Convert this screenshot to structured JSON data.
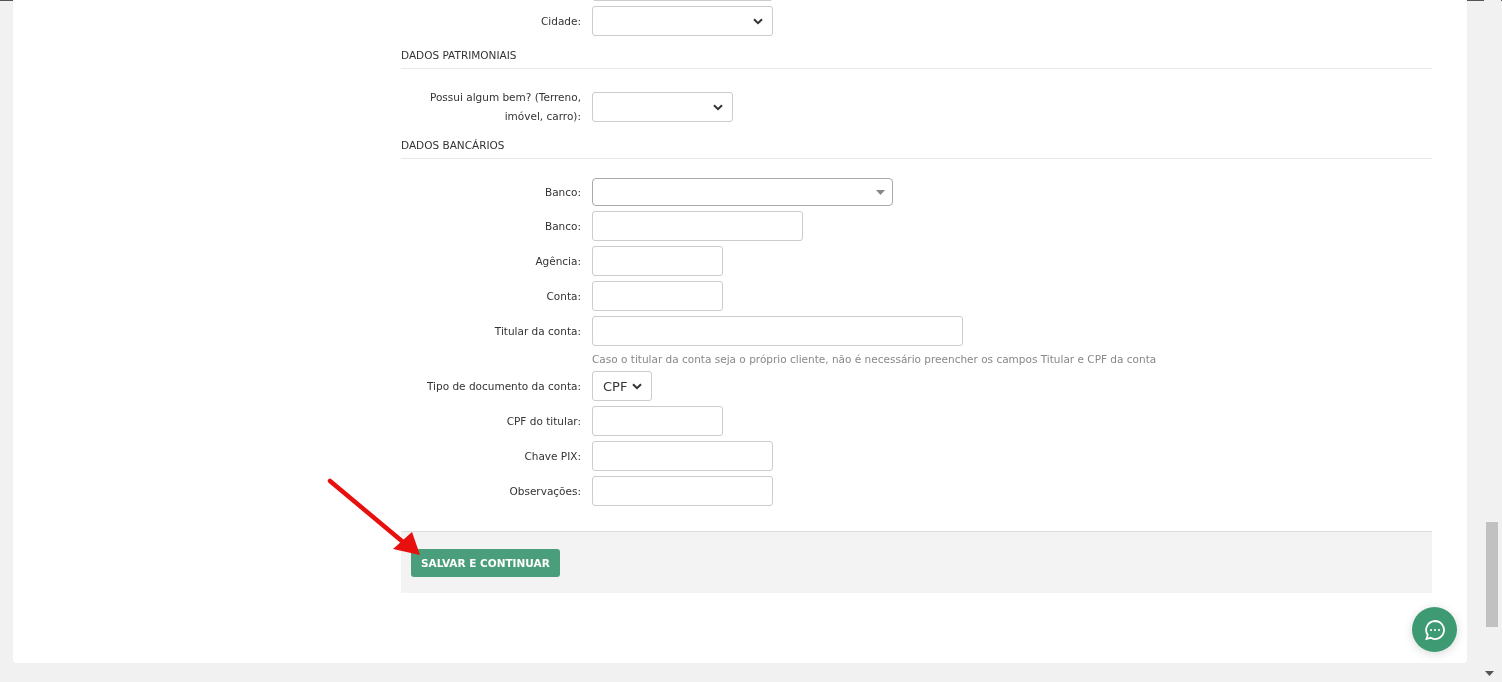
{
  "form": {
    "rows": [
      {
        "kind": "text",
        "label": ""
      },
      {
        "kind": "select",
        "label": "Cidade:"
      },
      {
        "kind": "section",
        "label": "DADOS PATRIMONIAIS"
      },
      {
        "kind": "select",
        "label": "Possui algum bem? (Terreno, imóvel, carro):"
      },
      {
        "kind": "section",
        "label": "DADOS BANCÁRIOS"
      },
      {
        "kind": "combo",
        "label": "Banco:"
      },
      {
        "kind": "text",
        "label": "Banco:"
      },
      {
        "kind": "text",
        "label": "Agência:"
      },
      {
        "kind": "text",
        "label": "Conta:"
      },
      {
        "kind": "text",
        "label": "Titular da conta:"
      },
      {
        "kind": "help",
        "label": "Caso o titular da conta seja o próprio cliente, não é necessário preencher os campos Titular e CPF da conta"
      },
      {
        "kind": "select",
        "label": "Tipo de documento da conta:",
        "value": "CPF"
      },
      {
        "kind": "text",
        "label": "CPF do titular:"
      },
      {
        "kind": "text",
        "label": "Chave PIX:"
      },
      {
        "kind": "text",
        "label": "Observações:"
      }
    ]
  },
  "footer": {
    "button": "SALVAR E CONTINUAR"
  }
}
